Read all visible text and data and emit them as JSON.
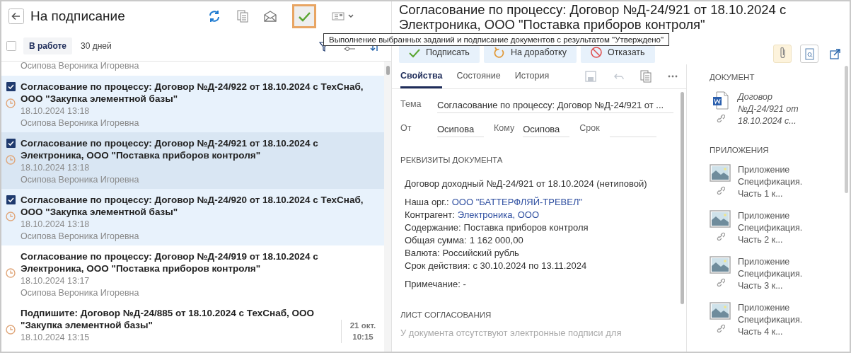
{
  "list_header": {
    "title": "На подписание",
    "sign_highlighted": true
  },
  "tooltip": "Выполнение выбранных заданий и подписание документов с результатом \"Утверждено\"",
  "filters": {
    "select_all_checked": false,
    "tabs": [
      {
        "label": "В работе",
        "selected": true
      },
      {
        "label": "30 дней",
        "selected": false
      }
    ]
  },
  "tasks": [
    {
      "author": "Осипова Вероника Игоревна",
      "checked": false,
      "selected": false
    },
    {
      "title": "Согласование по процессу: Договор №Д-24/922 от 18.10.2024 с ТехСнаб, ООО \"Закупка элементной базы\"",
      "date": "18.10.2024 13:18",
      "author": "Осипова Вероника Игоревна",
      "checked": true,
      "selected": false
    },
    {
      "title": "Согласование по процессу: Договор №Д-24/921 от 18.10.2024 с Электроника, ООО \"Поставка приборов контроля\"",
      "date": "18.10.2024 13:18",
      "author": "Осипова Вероника Игоревна",
      "checked": true,
      "selected": true
    },
    {
      "title": "Согласование по процессу: Договор №Д-24/920 от 18.10.2024 с ТехСнаб, ООО \"Закупка элементной базы\"",
      "date": "18.10.2024 13:18",
      "author": "Осипова Вероника Игоревна",
      "checked": true,
      "selected": false
    },
    {
      "title": "Согласование по процессу: Договор №Д-24/919 от 18.10.2024 с Электроника, ООО \"Поставка приборов контроля\"",
      "date": "18.10.2024 13:17",
      "author": "Осипова Вероника Игоревна",
      "checked": false,
      "selected": false
    },
    {
      "title": "Подпишите: Договор №Д-24/885 от 18.10.2024 с ТехСнаб, ООО \"Закупка элементной базы\"",
      "date": "18.10.2024 13:15",
      "checked": false,
      "selected": false,
      "badge_date": "21 окт.",
      "badge_time": "10:15"
    }
  ],
  "document": {
    "title": "Согласование по процессу: Договор №Д-24/921 от 18.10.2024 с Электроника, ООО \"Поставка приборов контроля\"",
    "actions": [
      {
        "kind": "approve",
        "label": "Подписать"
      },
      {
        "kind": "rework",
        "label": "На доработку"
      },
      {
        "kind": "reject",
        "label": "Отказать"
      }
    ],
    "tabs": [
      {
        "label": "Свойства",
        "selected": true
      },
      {
        "label": "Состояние",
        "selected": false
      },
      {
        "label": "История",
        "selected": false
      }
    ],
    "subject_label": "Тема",
    "subject": "Согласование по процессу: Договор №Д-24/921 от ...",
    "from_label": "От",
    "from": "Осипова",
    "to_label": "Кому",
    "to": "Осипова",
    "due_label": "Срок",
    "requisites_heading": "РЕКВИЗИТЫ ДОКУМЕНТА",
    "requisites_title": "Договор доходный №Д-24/921 от 18.10.2024 (нетиповой)",
    "requisites": [
      {
        "label": "Наша орг.:",
        "value": "ООО \"БАТТЕРФЛЯЙ-ТРЕВЕЛ\"",
        "link": true
      },
      {
        "label": "Контрагент:",
        "value": "Электроника, ООО",
        "link": true
      },
      {
        "label": "Содержание:",
        "value": "Поставка приборов контроля",
        "link": false
      },
      {
        "label": "Общая сумма:",
        "value": "1 162 000,00",
        "link": false
      },
      {
        "label": "Валюта:",
        "value": "Российский рубль",
        "link": false
      },
      {
        "label": "Срок действия:",
        "value": "с 30.10.2024 по 13.11.2024",
        "link": false
      }
    ],
    "note": "Примечание: -",
    "approval_heading": "ЛИСТ СОГЛАСОВАНИЯ",
    "approval_text": "У документа отсутствуют электронные подписи для"
  },
  "sidebar": {
    "document_heading": "ДОКУМЕНТ",
    "document_name": "Договор №Д-24/921 от 18.10.2024 с...",
    "attachments_heading": "ПРИЛОЖЕНИЯ",
    "attachments": [
      "Приложение Спецификация. Часть 1 к...",
      "Приложение Спецификация. Часть 2 к...",
      "Приложение Спецификация. Часть 3 к...",
      "Приложение Спецификация. Часть 4 к..."
    ]
  }
}
